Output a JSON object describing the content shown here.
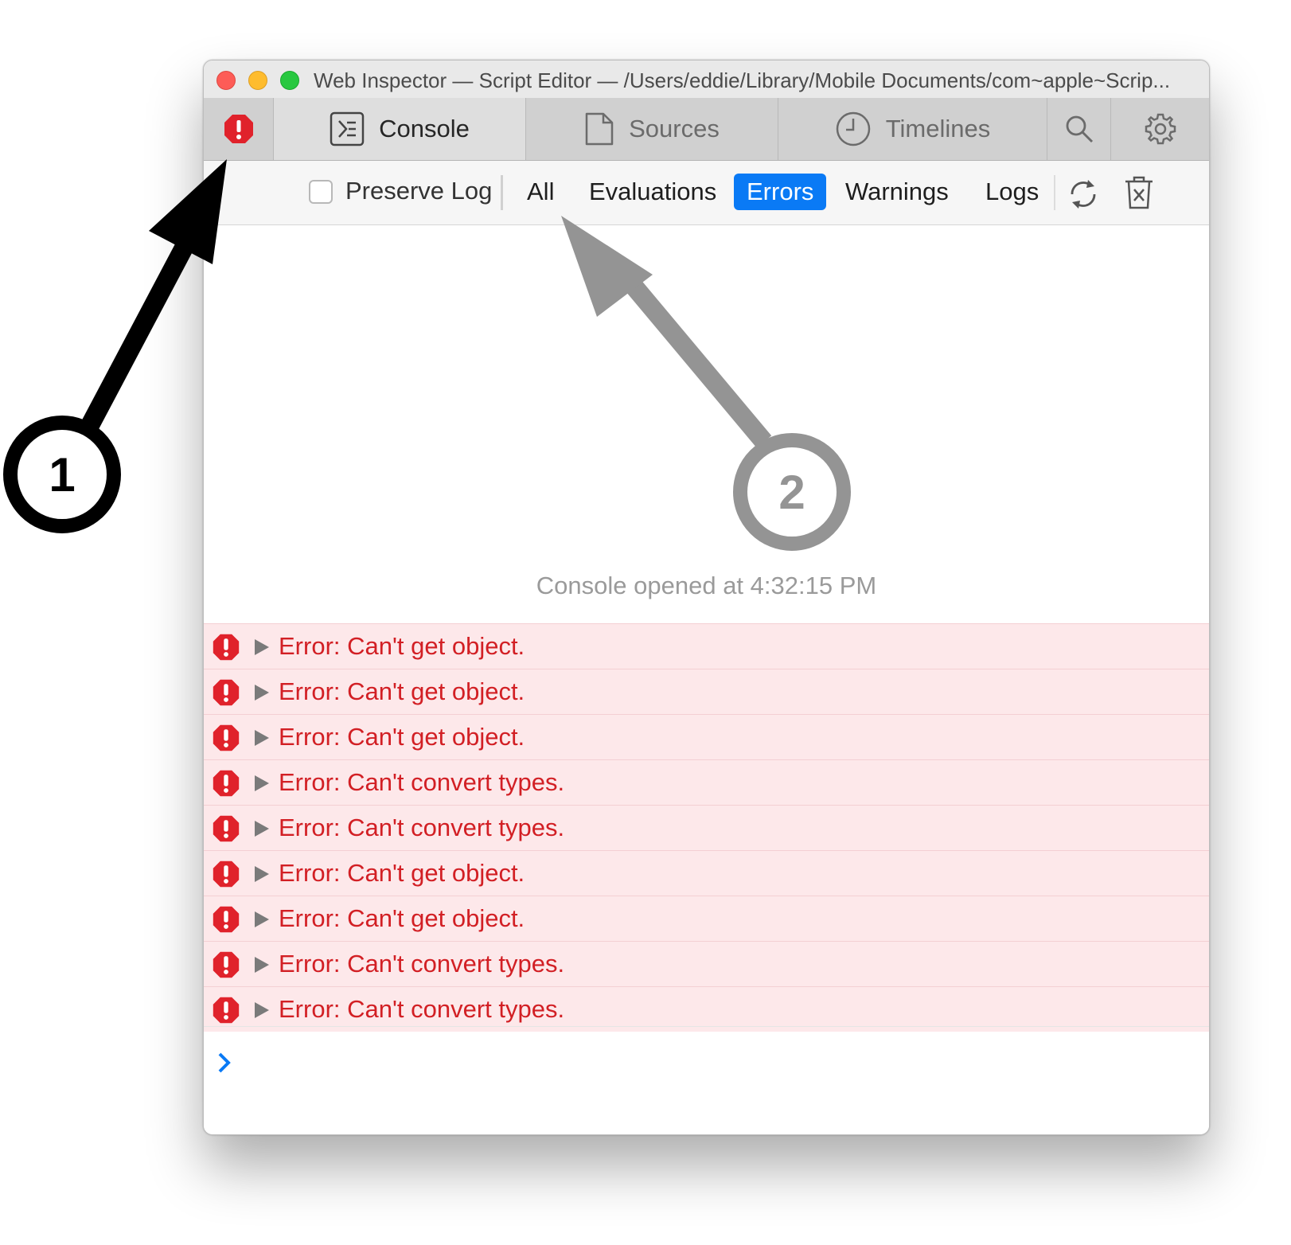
{
  "window": {
    "title": "Web Inspector — Script Editor — /Users/eddie/Library/Mobile Documents/com~apple~Scrip..."
  },
  "tabs": [
    {
      "label": "Console",
      "icon": "console-icon",
      "selected": true
    },
    {
      "label": "Sources",
      "icon": "document-icon",
      "selected": false
    },
    {
      "label": "Timelines",
      "icon": "clock-icon",
      "selected": false
    }
  ],
  "toolbar": {
    "error_indicator_icon": "error-octagon-icon",
    "search_icon": "search-icon",
    "settings_icon": "gear-icon"
  },
  "filterbar": {
    "preserve_log_label": "Preserve Log",
    "preserve_log_checked": false,
    "filters": [
      {
        "label": "All",
        "active": false
      },
      {
        "label": "Evaluations",
        "active": false
      },
      {
        "label": "Errors",
        "active": true
      },
      {
        "label": "Warnings",
        "active": false
      },
      {
        "label": "Logs",
        "active": false
      }
    ],
    "reload_icon": "reload-icon",
    "clear_icon": "trash-icon"
  },
  "console": {
    "opened_message": "Console opened at 4:32:15 PM",
    "messages": [
      "Error: Can't get object.",
      "Error: Can't get object.",
      "Error: Can't get object.",
      "Error: Can't convert types.",
      "Error: Can't convert types.",
      "Error: Can't get object.",
      "Error: Can't get object.",
      "Error: Can't convert types.",
      "Error: Can't convert types."
    ],
    "prompt_icon": "chevron-right-icon"
  },
  "annotations": {
    "callout_1": "1",
    "callout_2": "2"
  },
  "colors": {
    "accent": "#0a7af5",
    "error_text": "#d21f24",
    "error_row_bg": "#fde8ea",
    "error_icon": "#e0222b",
    "callout_1": "#000000",
    "callout_2": "#949494"
  }
}
